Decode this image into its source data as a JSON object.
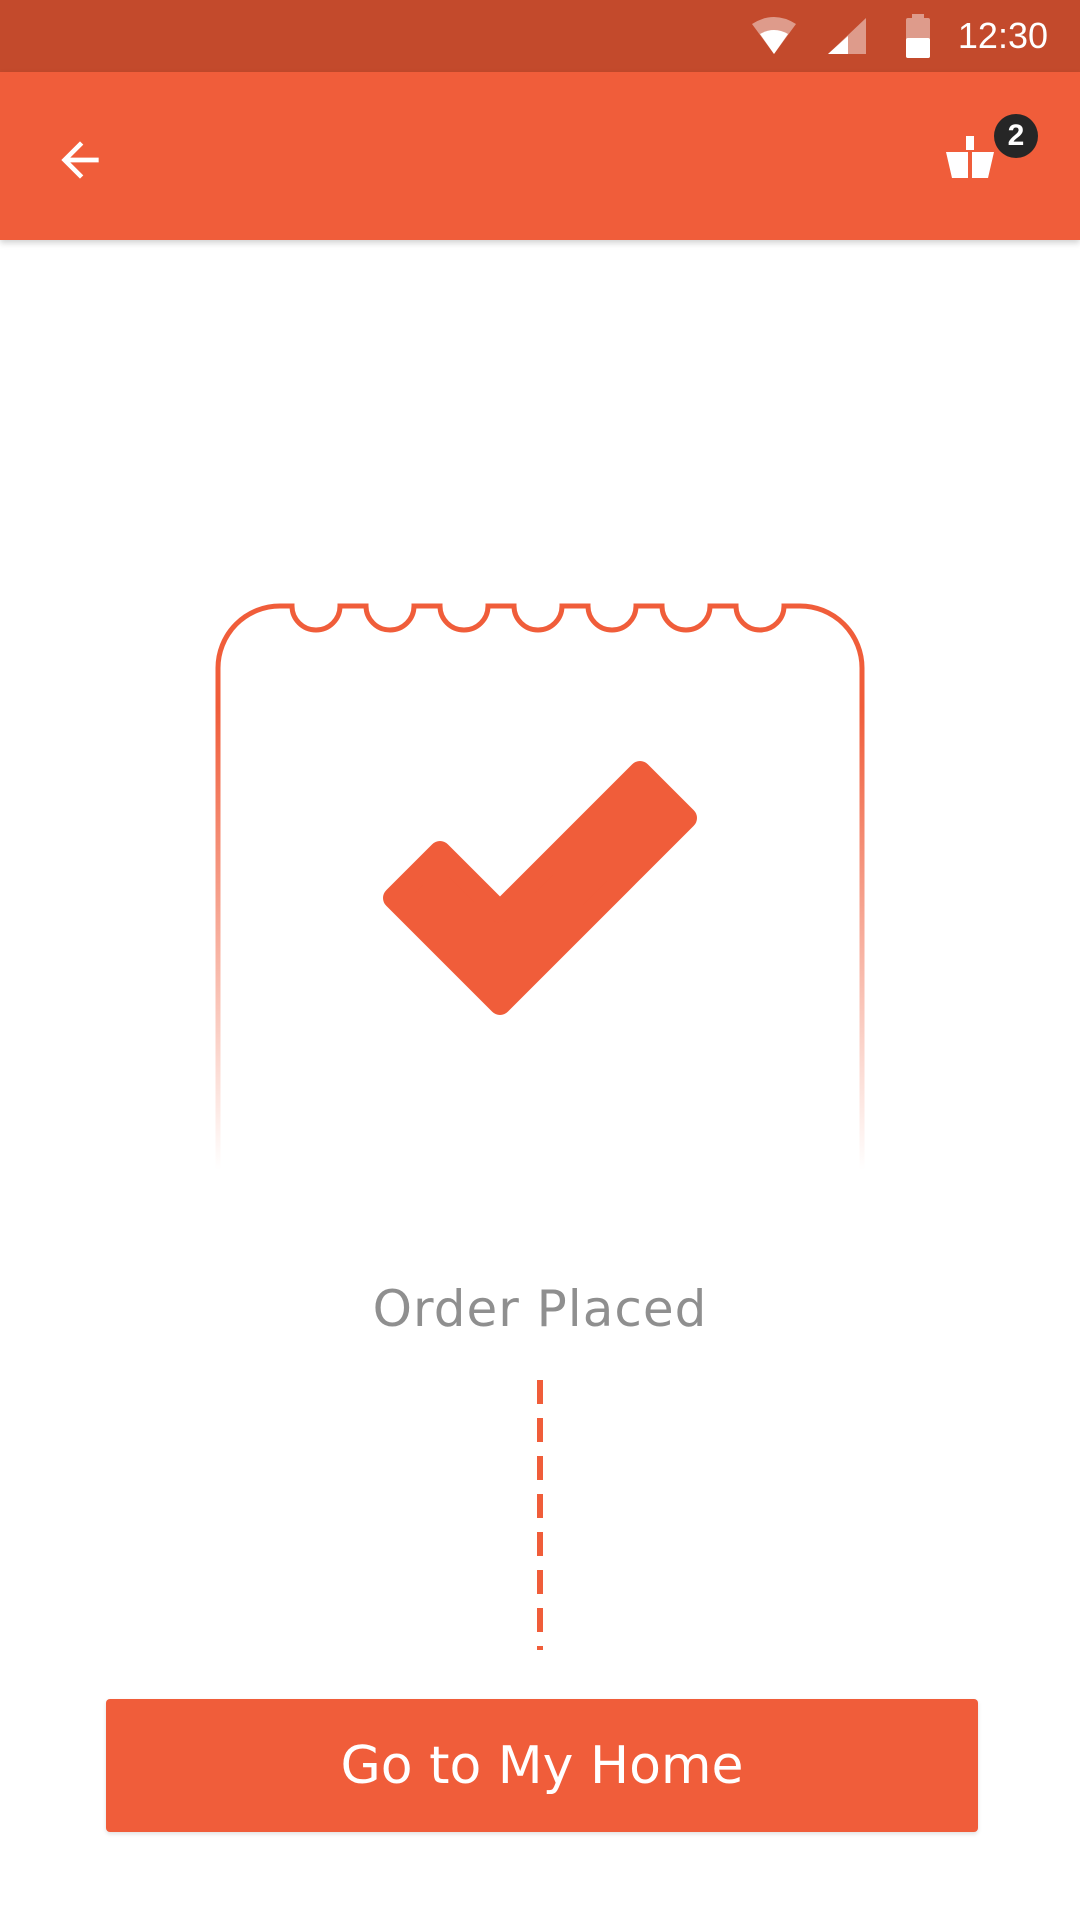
{
  "status_bar": {
    "time": "12:30",
    "icons": [
      "wifi-icon",
      "cellular-signal-icon",
      "battery-icon"
    ],
    "background": "#c34a2c"
  },
  "app_bar": {
    "back_icon": "arrow-back-icon",
    "cart_icon": "shopping-basket-icon",
    "cart_count": "2",
    "background": "#f05d3a"
  },
  "main": {
    "illustration": "receipt-checkmark",
    "status_text": "Order Placed",
    "primary_button_label": "Go to My Home"
  },
  "colors": {
    "accent": "#f05d3a",
    "status_text": "#8f8f8f",
    "badge": "#262626"
  }
}
